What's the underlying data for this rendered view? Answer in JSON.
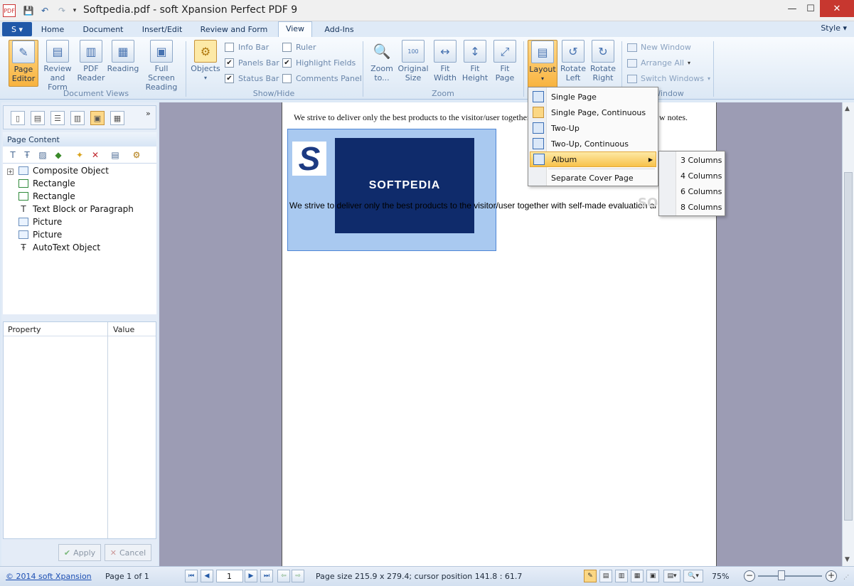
{
  "window": {
    "title": "Softpedia.pdf - soft Xpansion Perfect PDF 9",
    "minimize": "—",
    "maximize": "☐",
    "close": "✕"
  },
  "tabs": [
    "Home",
    "Document",
    "Insert/Edit",
    "Review and Form",
    "View",
    "Add-Ins"
  ],
  "active_tab": "View",
  "style_menu": "Style",
  "ribbon": {
    "document_views": {
      "group_label": "Document Views",
      "buttons": [
        {
          "line1": "Page",
          "line2": "Editor"
        },
        {
          "line1": "Review",
          "line2": "and Form"
        },
        {
          "line1": "PDF",
          "line2": "Reader"
        },
        {
          "line1": "Reading",
          "line2": ""
        },
        {
          "line1": "Full Screen",
          "line2": "Reading"
        }
      ]
    },
    "show_hide": {
      "group_label": "Show/Hide",
      "objects_label": "Objects",
      "checkboxes": [
        {
          "label": "Info Bar",
          "checked": false
        },
        {
          "label": "Panels Bar",
          "checked": true
        },
        {
          "label": "Status Bar",
          "checked": true
        },
        {
          "label": "Ruler",
          "checked": false
        },
        {
          "label": "Highlight Fields",
          "checked": true
        },
        {
          "label": "Comments Panel",
          "checked": false
        }
      ]
    },
    "zoom": {
      "group_label": "Zoom",
      "buttons": [
        {
          "line1": "Zoom",
          "line2": "to..."
        },
        {
          "line1": "Original",
          "line2": "Size"
        },
        {
          "line1": "Fit",
          "line2": "Width"
        },
        {
          "line1": "Fit",
          "line2": "Height"
        },
        {
          "line1": "Fit",
          "line2": "Page"
        }
      ]
    },
    "layout": {
      "layout_label": "Layout",
      "rotate_left": {
        "line1": "Rotate",
        "line2": "Left"
      },
      "rotate_right": {
        "line1": "Rotate",
        "line2": "Right"
      }
    },
    "window_group": {
      "group_label": "Window",
      "new_window": "New Window",
      "arrange_all": "Arrange All",
      "switch_windows": "Switch Windows"
    }
  },
  "layout_menu": {
    "items": [
      "Single Page",
      "Single Page, Continuous",
      "Two-Up",
      "Two-Up, Continuous",
      "Album",
      "Separate Cover Page"
    ],
    "highlighted": "Album"
  },
  "album_menu": {
    "items": [
      "3 Columns",
      "4 Columns",
      "6 Columns",
      "8 Columns"
    ]
  },
  "left_panel": {
    "title": "Page Content",
    "tree": [
      "Composite Object",
      "Rectangle",
      "Rectangle",
      "Text Block or Paragraph",
      "Picture",
      "Picture",
      "AutoText Object"
    ],
    "property_header": "Property",
    "value_header": "Value",
    "apply": "Apply",
    "cancel": "Cancel"
  },
  "document": {
    "line1": "We strive to deliver only the best products to the visitor/user together",
    "line1_tail": "w notes.",
    "logo_text": "SOFTPEDIA",
    "logo_letter": "S",
    "line2": "We strive to deliver only the best products to the visitor/user together with self-made evaluation ar",
    "watermark": "SOFTPEDIA"
  },
  "statusbar": {
    "copyright": "© 2014 soft Xpansion",
    "page_of": "Page 1 of 1",
    "page_input": "1",
    "page_size": "Page size 215.9 x 279.4; cursor position 141.8 : 61.7",
    "zoom": "75%"
  },
  "colors": {
    "accent": "#f8b33f",
    "ribbon_bg": "#dce8f5",
    "doc_bg": "#9c9cb4",
    "close_red": "#c7372f"
  }
}
